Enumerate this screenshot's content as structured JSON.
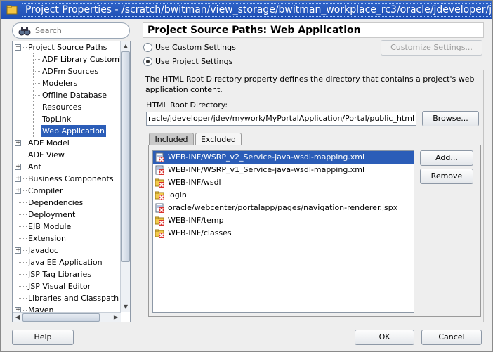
{
  "window": {
    "title": "Project Properties - /scratch/bwitman/view_storage/bwitman_workplace_rc3/oracle/jdeveloper/jdev/my"
  },
  "search": {
    "placeholder": "Search"
  },
  "tree": {
    "items": [
      {
        "label": "Project Source Paths",
        "level": 0,
        "expander": "minus"
      },
      {
        "label": "ADF Library Customi",
        "level": 1
      },
      {
        "label": "ADFm Sources",
        "level": 1
      },
      {
        "label": "Modelers",
        "level": 1
      },
      {
        "label": "Offline Database",
        "level": 1
      },
      {
        "label": "Resources",
        "level": 1
      },
      {
        "label": "TopLink",
        "level": 1
      },
      {
        "label": "Web Application",
        "level": 1,
        "selected": true
      },
      {
        "label": "ADF Model",
        "level": 0,
        "expander": "plus"
      },
      {
        "label": "ADF View",
        "level": 0
      },
      {
        "label": "Ant",
        "level": 0,
        "expander": "plus"
      },
      {
        "label": "Business Components",
        "level": 0,
        "expander": "plus"
      },
      {
        "label": "Compiler",
        "level": 0,
        "expander": "plus"
      },
      {
        "label": "Dependencies",
        "level": 0
      },
      {
        "label": "Deployment",
        "level": 0
      },
      {
        "label": "EJB Module",
        "level": 0
      },
      {
        "label": "Extension",
        "level": 0
      },
      {
        "label": "Javadoc",
        "level": 0,
        "expander": "plus"
      },
      {
        "label": "Java EE Application",
        "level": 0
      },
      {
        "label": "JSP Tag Libraries",
        "level": 0
      },
      {
        "label": "JSP Visual Editor",
        "level": 0
      },
      {
        "label": "Libraries and Classpath",
        "level": 0
      },
      {
        "label": "Maven",
        "level": 0,
        "expander": "plus"
      }
    ]
  },
  "panel": {
    "title": "Project Source Paths: Web Application",
    "radio_custom": "Use Custom Settings",
    "radio_project": "Use Project Settings",
    "customize_button": "Customize Settings...",
    "description": "The HTML Root Directory property defines the directory that contains a project's web application content.",
    "root_label": "HTML Root Directory:",
    "root_value": "racle/jdeveloper/jdev/mywork/MyPortalApplication/Portal/public_html",
    "browse_button": "Browse...",
    "tab_included": "Included",
    "tab_excluded": "Excluded",
    "add_button": "Add...",
    "remove_button": "Remove",
    "files": [
      {
        "path": "WEB-INF/WSRP_v2_Service-java-wsdl-mapping.xml",
        "icon": "xml-file-excluded-icon",
        "selected": true
      },
      {
        "path": "WEB-INF/WSRP_v1_Service-java-wsdl-mapping.xml",
        "icon": "xml-file-excluded-icon"
      },
      {
        "path": "WEB-INF/wsdl",
        "icon": "folder-excluded-icon"
      },
      {
        "path": "login",
        "icon": "folder-excluded-icon"
      },
      {
        "path": "oracle/webcenter/portalapp/pages/navigation-renderer.jspx",
        "icon": "jspx-file-excluded-icon"
      },
      {
        "path": "WEB-INF/temp",
        "icon": "folder-excluded-icon"
      },
      {
        "path": "WEB-INF/classes",
        "icon": "folder-excluded-icon"
      }
    ]
  },
  "footer": {
    "help_button": "Help",
    "ok_button": "OK",
    "cancel_button": "Cancel"
  },
  "colors": {
    "title_bar": "#1f4fb4",
    "selection": "#2b5db8",
    "dialog_bg": "#eeeeee"
  }
}
